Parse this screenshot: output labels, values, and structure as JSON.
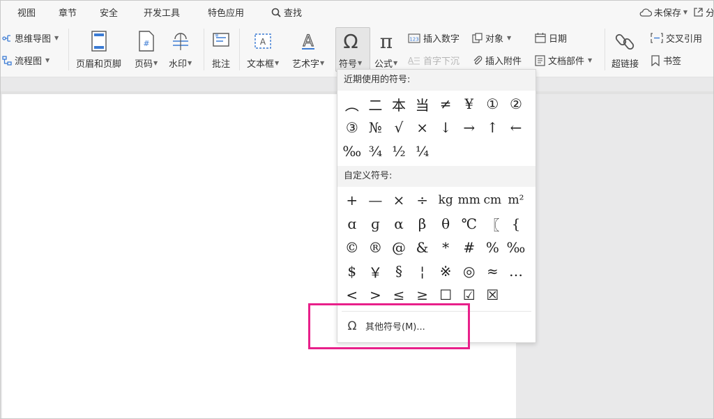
{
  "menubar": {
    "items": [
      "视图",
      "章节",
      "安全",
      "开发工具",
      "特色应用"
    ],
    "search": "查找",
    "unsaved": "未保存",
    "share": "分"
  },
  "ribbon": {
    "mindmap": "思维导图",
    "flowchart": "流程图",
    "header_footer": "页眉和页脚",
    "page_number": "页码",
    "watermark": "水印",
    "comment": "批注",
    "textbox": "文本框",
    "wordart": "艺术字",
    "symbol": "符号",
    "formula": "公式",
    "insert_number": "插入数字",
    "object": "对象",
    "date": "日期",
    "drop_cap": "首字下沉",
    "attachment": "插入附件",
    "doc_parts": "文档部件",
    "hyperlink": "超链接",
    "cross_ref": "交叉引用",
    "bookmark": "书签"
  },
  "symbol_menu": {
    "recent_title": "近期使用的符号:",
    "recent": [
      "︵",
      "二",
      "本",
      "当",
      "≠",
      "¥",
      "①",
      "②",
      "③",
      "№",
      "√",
      "×",
      "↓",
      "→",
      "↑",
      "←",
      "‰",
      "¾",
      "½",
      "¼"
    ],
    "custom_title": "自定义符号:",
    "custom": [
      "+",
      "—",
      "×",
      "÷",
      "kg",
      "mm",
      "cm",
      "m²",
      "ɑ",
      "ɡ",
      "α",
      "β",
      "θ",
      "℃",
      "〖",
      "{",
      "©",
      "®",
      "@",
      "&",
      "*",
      "#",
      "%",
      "‰",
      "$",
      "￥",
      "§",
      "¦",
      "※",
      "◎",
      "≈",
      "…",
      "<",
      ">",
      "≤",
      "≥",
      "☐",
      "☑",
      "☒"
    ],
    "more": "其他符号(M)..."
  },
  "colors": {
    "highlight": "#e8208a",
    "page": "#ffffff",
    "ribbon": "#f7f7f7"
  }
}
